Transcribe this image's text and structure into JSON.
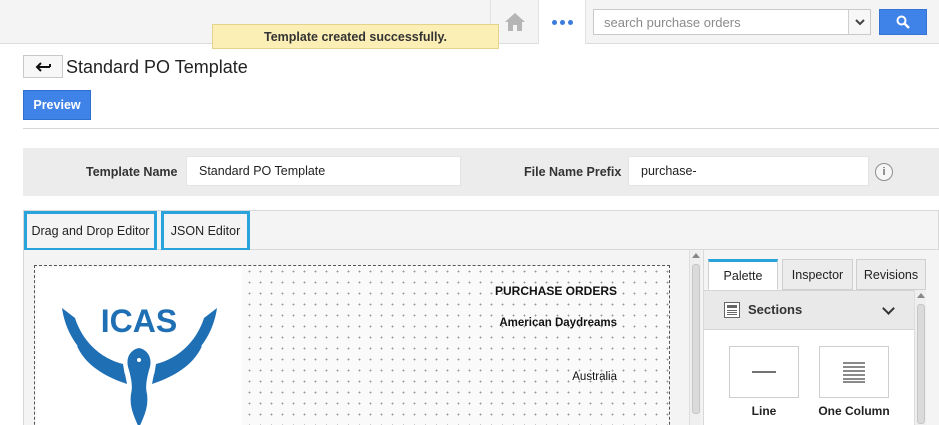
{
  "topbar": {
    "search": {
      "placeholder": "search purchase orders",
      "value": ""
    },
    "icons": {
      "home": "home-icon",
      "more": "more-dots-icon",
      "dropdown": "chevron-down-icon",
      "search": "search-icon"
    }
  },
  "toast": {
    "message": "Template created successfully."
  },
  "header": {
    "title": "Standard PO Template",
    "preview_label": "Preview"
  },
  "form": {
    "template_name_label": "Template Name",
    "template_name_value": "Standard PO Template",
    "prefix_label": "File Name Prefix",
    "prefix_value": "purchase-",
    "info_glyph": "i"
  },
  "editor_tabs": [
    {
      "label": "Drag and Drop Editor"
    },
    {
      "label": "JSON Editor"
    }
  ],
  "canvas": {
    "logo_text": "ICAS",
    "heading": "PURCHASE ORDERS",
    "company": "American Daydreams",
    "country": "Australia"
  },
  "side_panel": {
    "tabs": [
      {
        "label": "Palette",
        "active": true
      },
      {
        "label": "Inspector",
        "active": false
      },
      {
        "label": "Revisions",
        "active": false
      }
    ],
    "section_title": "Sections",
    "items": [
      {
        "label": "Line",
        "icon": "line-icon"
      },
      {
        "label": "One Column",
        "icon": "one-column-icon"
      }
    ]
  },
  "colors": {
    "accent": "#3f82e8",
    "tab_highlight": "#2aa2dc",
    "toast_bg": "#fbefb5",
    "logo_blue": "#1f6fb5"
  }
}
